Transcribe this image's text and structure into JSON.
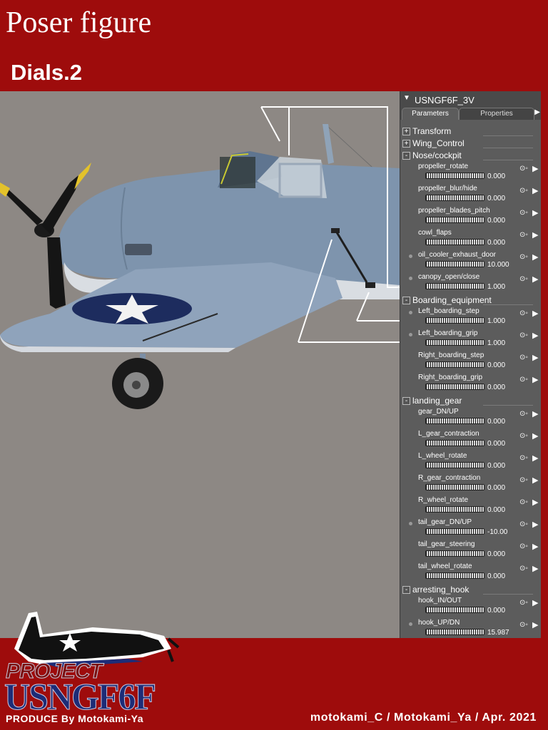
{
  "header": {
    "title": "Poser figure",
    "subtitle": "Dials.2"
  },
  "panel": {
    "title": "USNGF6F_3V",
    "tabs": [
      "Parameters",
      "Properties"
    ],
    "items": [
      {
        "kind": "group",
        "label": "Transform",
        "state": "+"
      },
      {
        "kind": "group",
        "label": "Wing_Control",
        "state": "+"
      },
      {
        "kind": "group",
        "label": "Nose/cockpit",
        "state": "-"
      },
      {
        "kind": "param",
        "label": "propeller_rotate",
        "value": "0.000",
        "dot": false
      },
      {
        "kind": "param",
        "label": "propeller_blur/hide",
        "value": "0.000",
        "dot": false
      },
      {
        "kind": "param",
        "label": "propeller_blades_pitch",
        "value": "0.000",
        "dot": false
      },
      {
        "kind": "param",
        "label": "cowl_flaps",
        "value": "0.000",
        "dot": false
      },
      {
        "kind": "param",
        "label": "oil_cooler_exhaust_door",
        "value": "10.000",
        "dot": true
      },
      {
        "kind": "param",
        "label": "canopy_open/close",
        "value": "1.000",
        "dot": true
      },
      {
        "kind": "group",
        "label": "Boarding_equipment",
        "state": "-"
      },
      {
        "kind": "param",
        "label": "Left_boarding_step",
        "value": "1.000",
        "dot": true
      },
      {
        "kind": "param",
        "label": "Left_boarding_grip",
        "value": "1.000",
        "dot": true
      },
      {
        "kind": "param",
        "label": "Right_boarding_step",
        "value": "0.000",
        "dot": false
      },
      {
        "kind": "param",
        "label": "Right_boarding_grip",
        "value": "0.000",
        "dot": false
      },
      {
        "kind": "group",
        "label": "landing_gear",
        "state": "-"
      },
      {
        "kind": "param",
        "label": "gear_DN/UP",
        "value": "0.000",
        "dot": false
      },
      {
        "kind": "param",
        "label": "L_gear_contraction",
        "value": "0.000",
        "dot": false
      },
      {
        "kind": "param",
        "label": "L_wheel_rotate",
        "value": "0.000",
        "dot": false
      },
      {
        "kind": "param",
        "label": "R_gear_contraction",
        "value": "0.000",
        "dot": false
      },
      {
        "kind": "param",
        "label": "R_wheel_rotate",
        "value": "0.000",
        "dot": false
      },
      {
        "kind": "param",
        "label": "tail_gear_DN/UP",
        "value": "-10.00",
        "dot": true
      },
      {
        "kind": "param",
        "label": "tail_gear_steering",
        "value": "0.000",
        "dot": false
      },
      {
        "kind": "param",
        "label": "tail_wheel_rotate",
        "value": "0.000",
        "dot": false
      },
      {
        "kind": "group",
        "label": "arresting_hook",
        "state": "-"
      },
      {
        "kind": "param",
        "label": "hook_IN/OUT",
        "value": "0.000",
        "dot": false
      },
      {
        "kind": "param",
        "label": "hook_UP/DN",
        "value": "15.987",
        "dot": true
      }
    ]
  },
  "logo": {
    "project": "PROJECT",
    "main": "USNGF6F",
    "produce": "PRODUCE By Motokami-Ya"
  },
  "footer": {
    "credit": "motokami_C / Motokami_Ya / Apr. 2021"
  },
  "colors": {
    "brand_red": "#9e0c0c",
    "panel_gray": "#5c5c5c",
    "navy": "#1d2c77"
  }
}
